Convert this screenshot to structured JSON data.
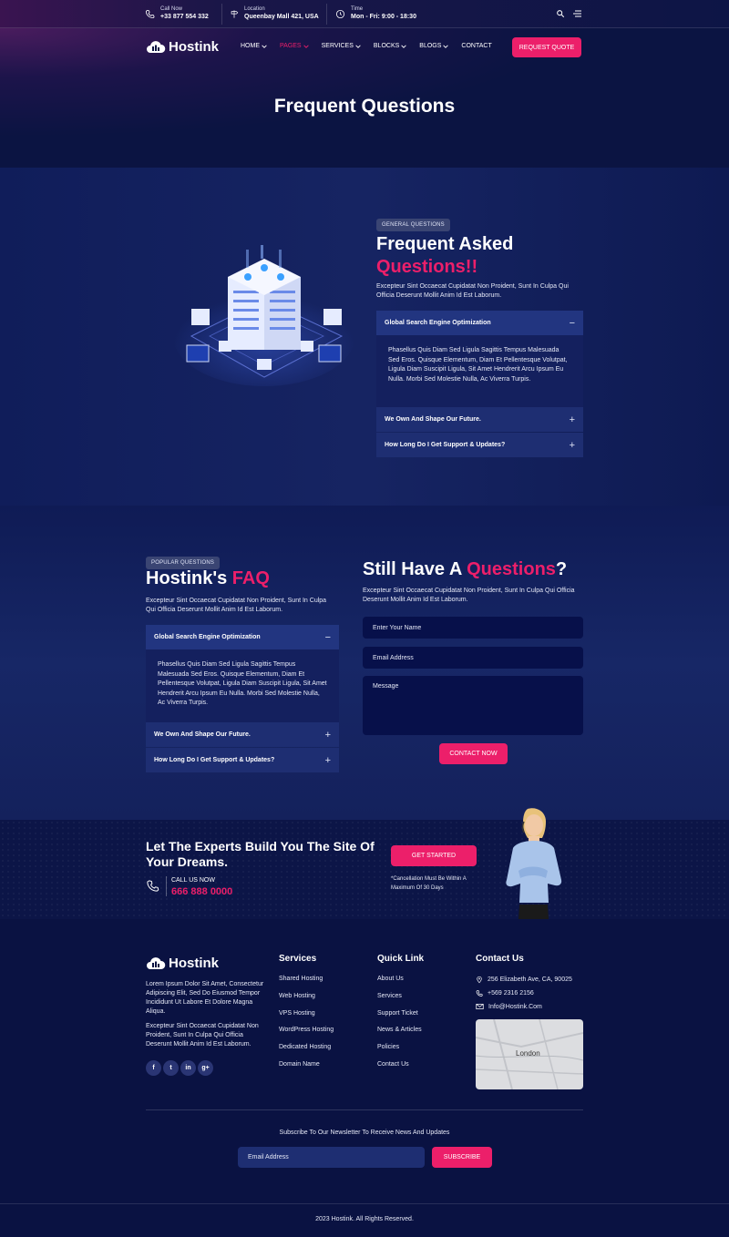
{
  "topbar": {
    "call": {
      "label": "Call Now",
      "value": "+33 877 554 332"
    },
    "location": {
      "label": "Location",
      "value": "Queenbay Mall 421, USA"
    },
    "time": {
      "label": "Time",
      "value": "Mon - Fri: 9:00 - 18:30"
    }
  },
  "header": {
    "logo": "Hostink",
    "nav": [
      {
        "label": "HOME",
        "dropdown": true,
        "active": false
      },
      {
        "label": "PAGES",
        "dropdown": true,
        "active": true
      },
      {
        "label": "SERVICES",
        "dropdown": true,
        "active": false
      },
      {
        "label": "BLOCKS",
        "dropdown": true,
        "active": false
      },
      {
        "label": "BLOGS",
        "dropdown": true,
        "active": false
      },
      {
        "label": "CONTACT",
        "dropdown": false,
        "active": false
      }
    ],
    "cta": "REQUEST QUOTE"
  },
  "hero": {
    "title": "Frequent Questions"
  },
  "general": {
    "tag": "GENERAL QUESTIONS",
    "title_line1": "Frequent Asked",
    "title_line2": "Questions!!",
    "intro": "Excepteur Sint Occaecat Cupidatat Non Proident, Sunt In Culpa Qui Officia Deserunt Mollit Anim Id Est Laborum.",
    "accordion": [
      {
        "q": "Global Search Engine Optimization",
        "open": true,
        "a": "Phasellus Quis Diam Sed Ligula Sagittis Tempus Malesuada Sed Eros. Quisque Elementum, Diam Et Pellentesque Volutpat, Ligula Diam Suscipit Ligula, Sit Amet Hendrerit Arcu Ipsum Eu Nulla. Morbi Sed Molestie Nulla, Ac Viverra Turpis."
      },
      {
        "q": "We Own And Shape Our Future.",
        "open": false
      },
      {
        "q": "How Long Do I Get Support & Updates?",
        "open": false
      }
    ]
  },
  "popular": {
    "tag": "POPULAR QUESTIONS",
    "title_a": "Hostink's",
    "title_b": "FAQ",
    "intro": "Excepteur Sint Occaecat Cupidatat Non Proident, Sunt In Culpa Qui Officia Deserunt Mollit Anim Id Est Laborum.",
    "accordion": [
      {
        "q": "Global Search Engine Optimization",
        "open": true,
        "a": "Phasellus Quis Diam Sed Ligula Sagittis Tempus Malesuada Sed Eros. Quisque Elementum, Diam Et Pellentesque Volutpat, Ligula Diam Suscipit Ligula, Sit Amet Hendrerit Arcu Ipsum Eu Nulla. Morbi Sed Molestie Nulla, Ac Viverra Turpis."
      },
      {
        "q": "We Own And Shape Our Future.",
        "open": false
      },
      {
        "q": "How Long Do I Get Support & Updates?",
        "open": false
      }
    ]
  },
  "contact_form": {
    "title_a": "Still Have A",
    "title_b": "Questions",
    "title_c": "?",
    "intro": "Excepteur Sint Occaecat Cupidatat Non Proident, Sunt In Culpa Qui Officia Deserunt Mollit Anim Id Est Laborum.",
    "name_placeholder": "Enter Your Name",
    "email_placeholder": "Email Address",
    "message_placeholder": "Message",
    "submit": "CONTACT NOW"
  },
  "cta": {
    "title": "Let The Experts Build You The Site Of Your Dreams.",
    "call_label": "CALL US NOW",
    "phone": "666 888 0000",
    "button": "GET STARTED",
    "note": "*Cancellation Must Be Within A Maximum Of 30 Days"
  },
  "footer": {
    "logo": "Hostink",
    "about1": "Lorem Ipsum Dolor Sit Amet, Consectetur Adipiscing Elit, Sed Do Eiusmod Tempor Incididunt Ut Labore Et Dolore Magna Aliqua.",
    "about2": "Excepteur Sint Occaecat Cupidatat Non Proident, Sunt In Culpa Qui Officia Deserunt Mollit Anim Id Est Laborum.",
    "social": [
      "f",
      "t",
      "in",
      "g+"
    ],
    "services_title": "Services",
    "services": [
      "Shared Hosting",
      "Web Hosting",
      "VPS Hosting",
      "WordPress Hosting",
      "Dedicated Hosting",
      "Domain Name"
    ],
    "quick_title": "Quick Link",
    "quick": [
      "About Us",
      "Services",
      "Support Ticket",
      "News & Articles",
      "Policies",
      "Contact Us"
    ],
    "contact_title": "Contact Us",
    "address": "256 Elizabeth Ave, CA, 90025",
    "phone": "+569 2316 2156",
    "email": "Info@Hostink.Com",
    "map_label": "London",
    "newsletter_text": "Subscribe To Our Newsletter To Receive News And Updates",
    "newsletter_placeholder": "Email Address",
    "subscribe": "SUBSCRIBE",
    "copyright": "2023 Hostink. All Rights Reserved."
  },
  "colors": {
    "accent": "#ec1f6a",
    "background": "#0b1442",
    "panel": "#223580"
  }
}
